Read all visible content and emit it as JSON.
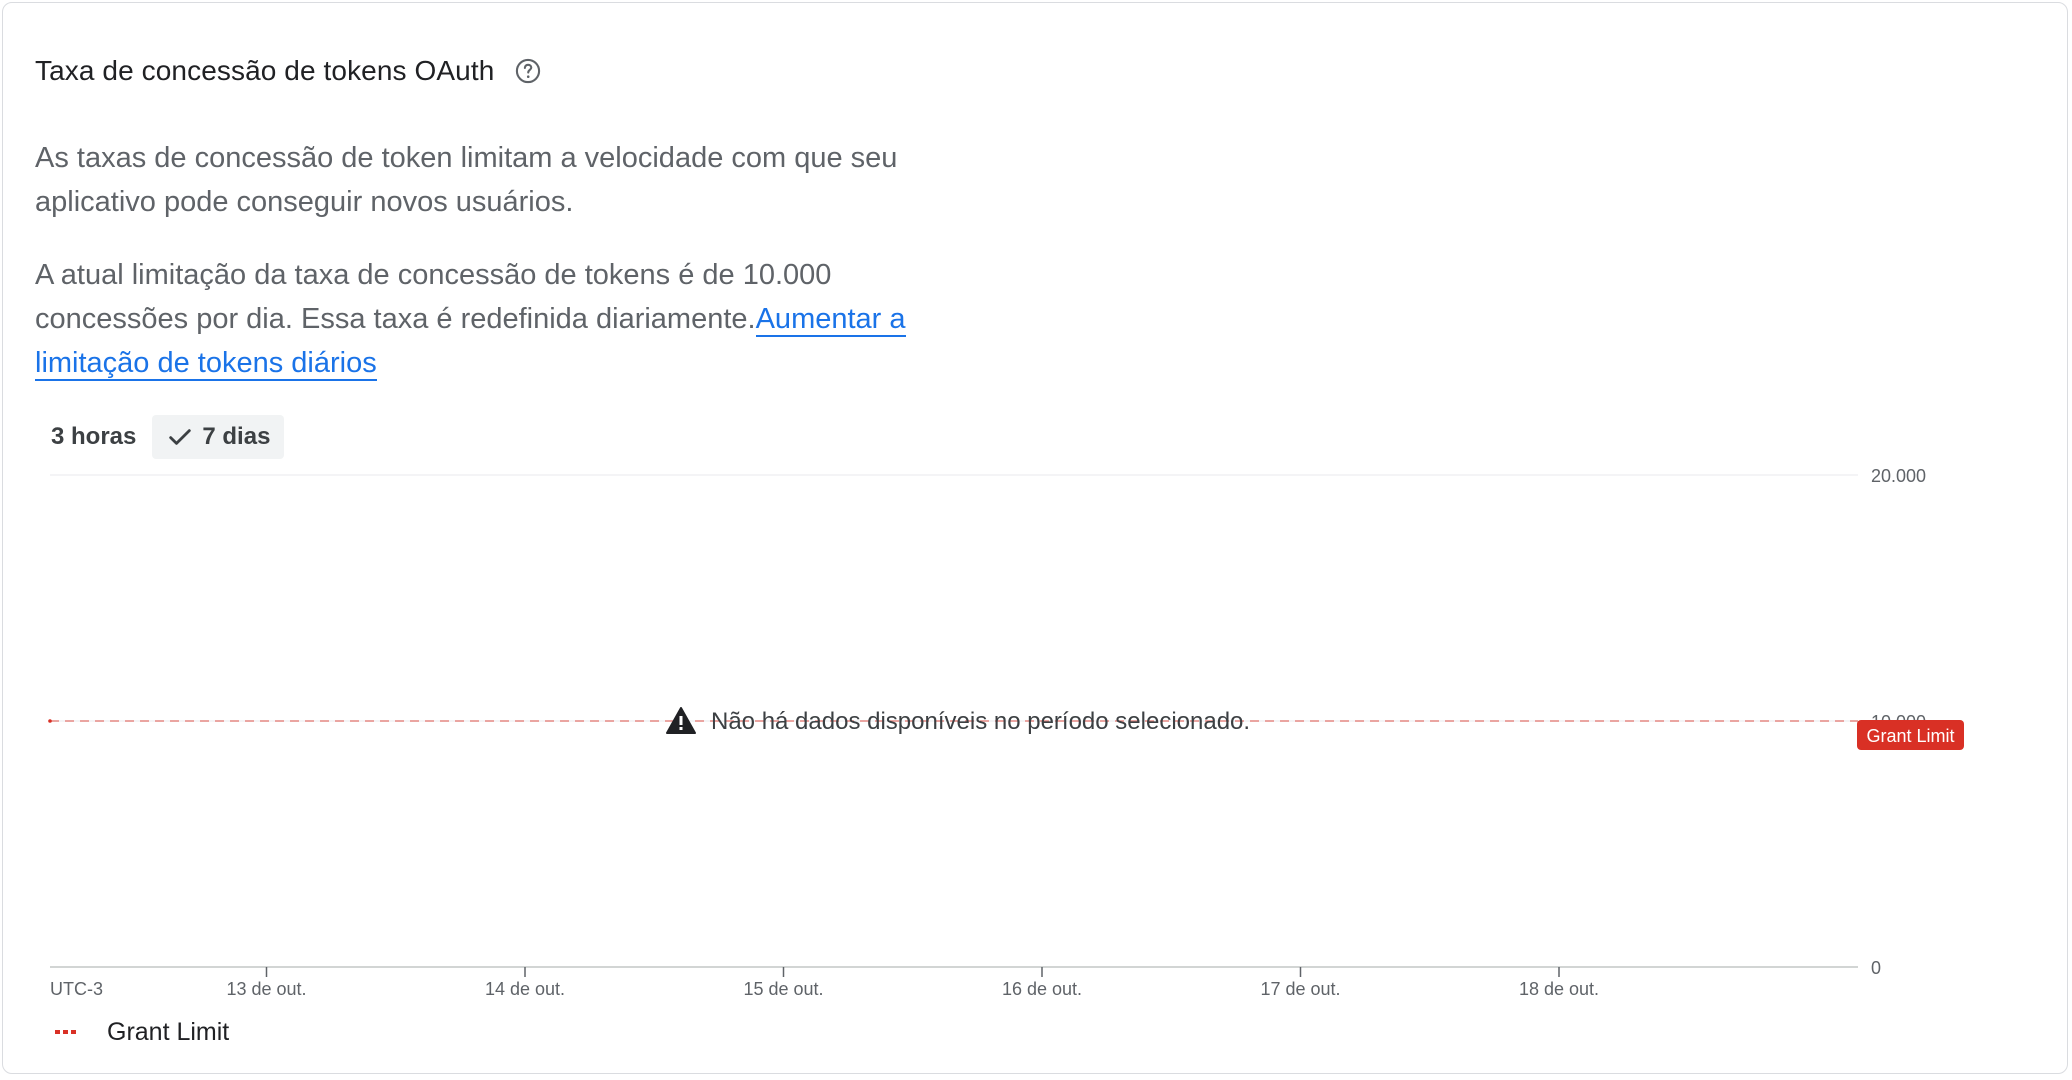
{
  "card": {
    "title": "Taxa de concessão de tokens OAuth",
    "help_icon": "help-circle-icon",
    "description_1": "As taxas de concessão de token limitam a velocidade com que seu aplicativo pode conseguir novos usuários.",
    "description_2_prefix": "A atual limitação da taxa de concessão de tokens é de 10.000 concessões por dia. Essa taxa é redefinida diariamente.",
    "increase_link": "Aumentar a limitação de tokens diários"
  },
  "range_toggle": {
    "options": [
      {
        "label": "3 horas",
        "selected": false
      },
      {
        "label": "7 dias",
        "selected": true,
        "icon": "check-icon"
      }
    ]
  },
  "chart_data": {
    "type": "line",
    "timezone_label": "UTC-3",
    "x_tick_labels": [
      "13 de out.",
      "14 de out.",
      "15 de out.",
      "16 de out.",
      "17 de out.",
      "18 de out."
    ],
    "y_tick_labels": [
      "20.000",
      "10.000",
      "0"
    ],
    "y_ticks": [
      20000,
      10000,
      0
    ],
    "ylim": [
      0,
      20000
    ],
    "series": [
      {
        "name": "Grant Limit",
        "style": "dashed",
        "color": "#d93025",
        "values": [
          10000,
          10000,
          10000,
          10000,
          10000,
          10000,
          10000
        ]
      }
    ],
    "threshold_badge": "Grant Limit",
    "no_data_message": "Não há dados disponíveis no período selecionado.",
    "no_data_icon": "warning-icon",
    "legend": [
      {
        "label": "Grant Limit",
        "color": "#d93025",
        "style": "dashed"
      }
    ],
    "grid": true
  },
  "colors": {
    "link": "#1a73e8",
    "grant_limit": "#d93025",
    "badge_bg": "#d93025",
    "grid": "#e8eaed"
  }
}
